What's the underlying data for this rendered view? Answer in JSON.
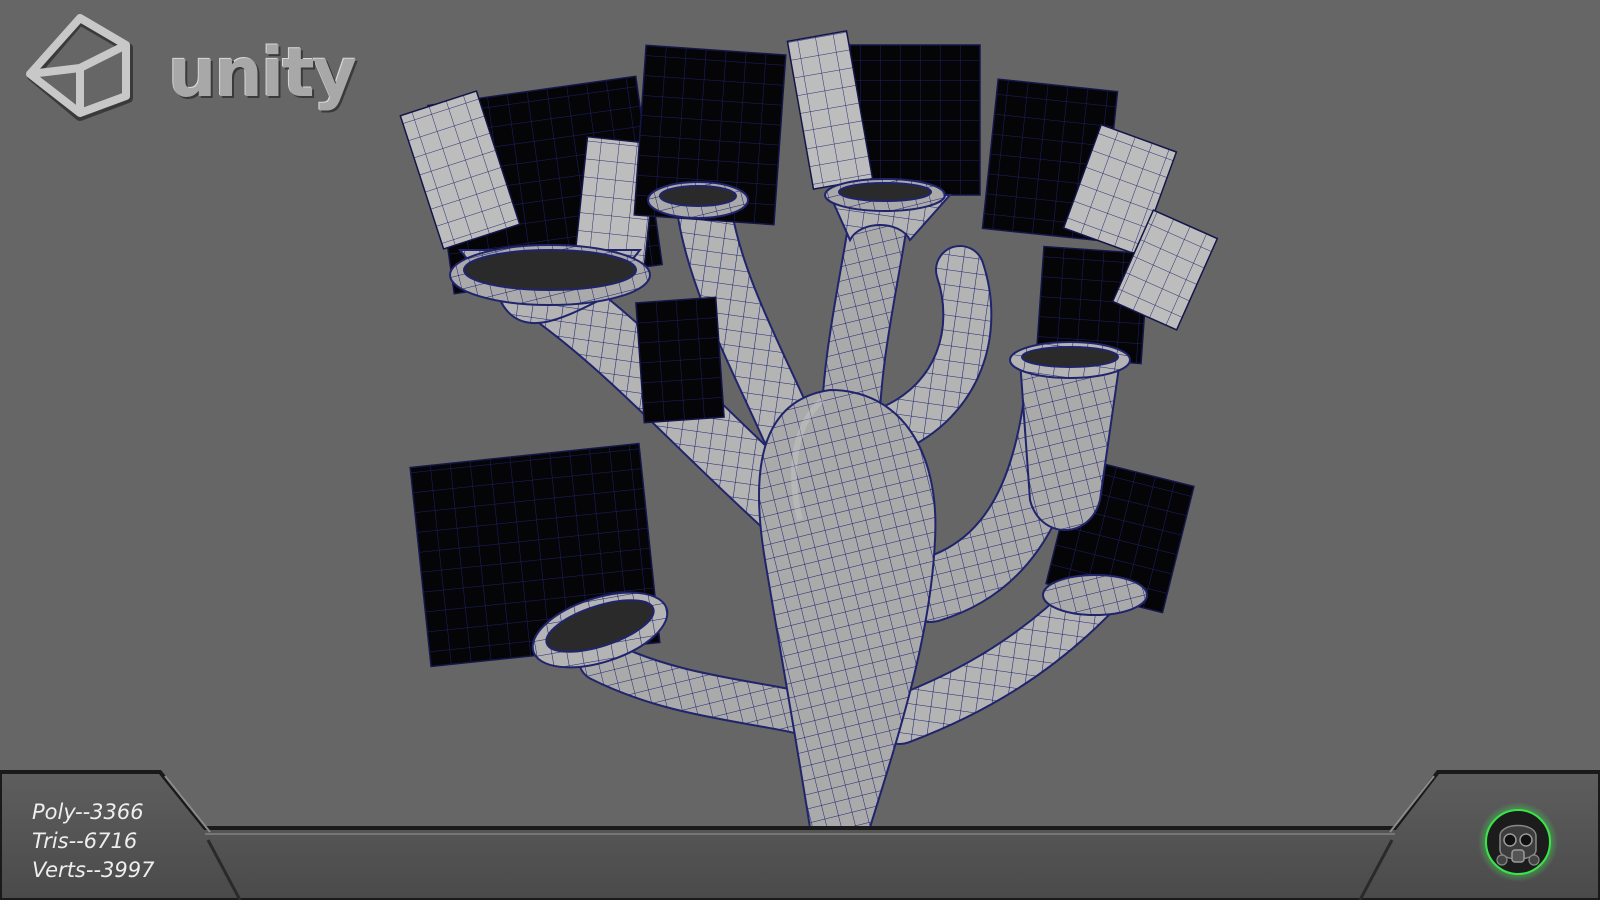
{
  "logo": {
    "text": "unity",
    "icon": "unity-cube-icon"
  },
  "stats": {
    "poly": "Poly--3366",
    "tris": "Tris--6716",
    "verts": "Verts--3997"
  },
  "badge": {
    "icon": "gas-mask-icon"
  },
  "colors": {
    "background": "#666666",
    "mesh": "#b4b4b4",
    "wireframe": "#1a1e6e",
    "card": "#000000",
    "badge_glow": "#39e64a"
  }
}
